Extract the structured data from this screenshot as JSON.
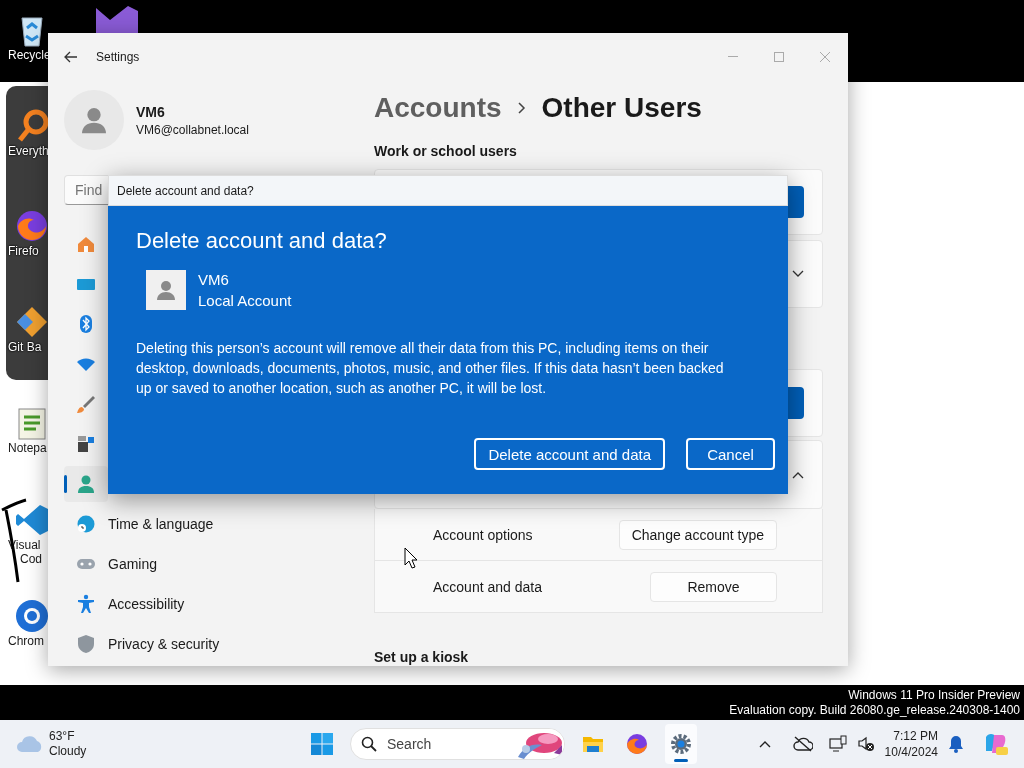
{
  "desktop": {
    "icons": [
      {
        "label": "Recycle"
      },
      {
        "label": "Everyth"
      },
      {
        "label": "Firefo"
      },
      {
        "label": "Git Ba"
      },
      {
        "label": "Notepa"
      },
      {
        "label": "Visual",
        "label_2": "Cod"
      },
      {
        "label": "Chrom"
      }
    ],
    "watermark": [
      "Windows 11 Pro Insider Preview",
      "Evaluation copy. Build 26080.ge_release.240308-1400"
    ]
  },
  "settings_window": {
    "title": "Settings",
    "profile": {
      "name": "VM6",
      "email": "VM6@collabnet.local"
    },
    "search": {
      "placeholder": "Find"
    },
    "nav": [
      {
        "selected": false
      },
      {
        "selected": false
      },
      {
        "selected": false
      },
      {
        "selected": false
      },
      {
        "selected": false
      },
      {
        "selected": false
      },
      {
        "selected": true
      },
      {
        "label": "Time & language",
        "selected": false
      },
      {
        "label": "Gaming",
        "selected": false
      },
      {
        "label": "Accessibility",
        "selected": false
      },
      {
        "label": "Privacy & security",
        "selected": false
      }
    ],
    "breadcrumb": {
      "parent": "Accounts",
      "current": "Other Users"
    },
    "section_heading": "Work or school users",
    "collapsed_user": {
      "expanded": false
    },
    "expanded_user": {
      "expanded": true,
      "rows": [
        {
          "label": "Account options",
          "button": "Change account type"
        },
        {
          "label": "Account and data",
          "button": "Remove"
        }
      ]
    },
    "kiosk_heading": "Set up a kiosk"
  },
  "dialog": {
    "title": "Delete account and data?",
    "heading": "Delete account and data?",
    "account_name": "VM6",
    "account_type": "Local Account",
    "message": "Deleting this person’s account will remove all their data from this PC, including items on their desktop, downloads, documents, photos, music, and other files. If this data hasn’t been backed up or saved to another location, such as another PC, it will be lost.",
    "buttons": [
      "Delete account and data",
      "Cancel"
    ]
  },
  "taskbar": {
    "weather": {
      "temperature": "63°F",
      "condition": "Cloudy"
    },
    "search": {
      "placeholder": "Search"
    },
    "apps": [
      {
        "selected": false
      },
      {
        "selected": false
      },
      {
        "selected": true
      }
    ],
    "time": "7:12 PM",
    "date": "10/4/2024"
  }
}
